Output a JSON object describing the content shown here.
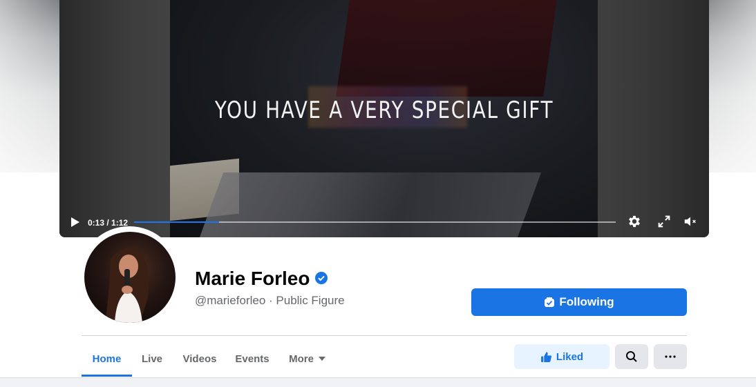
{
  "cover": {
    "overlay_text": "YOU HAVE A VERY SPECIAL GIFT",
    "video": {
      "time": "0:13 / 1:12",
      "progress": 0.176,
      "muted": true
    }
  },
  "profile": {
    "name": "Marie Forleo",
    "verified": true,
    "handle": "@marieforleo · Public Figure",
    "follow_label": "Following"
  },
  "tabs": [
    {
      "label": "Home",
      "active": true
    },
    {
      "label": "Live"
    },
    {
      "label": "Videos"
    },
    {
      "label": "Events"
    },
    {
      "label": "More"
    }
  ],
  "actions": {
    "liked_label": "Liked"
  },
  "colors": {
    "accent": "#1b74e4",
    "liked_bg": "#e7f3ff",
    "secondary_btn": "#e4e6eb",
    "muted_text": "#65676b"
  },
  "icons": [
    "play-icon",
    "settings-icon",
    "fullscreen-icon",
    "muted-icon",
    "verified-icon",
    "following-icon",
    "caret-down-icon",
    "thumbs-up-icon",
    "search-icon",
    "more-dots-icon"
  ]
}
